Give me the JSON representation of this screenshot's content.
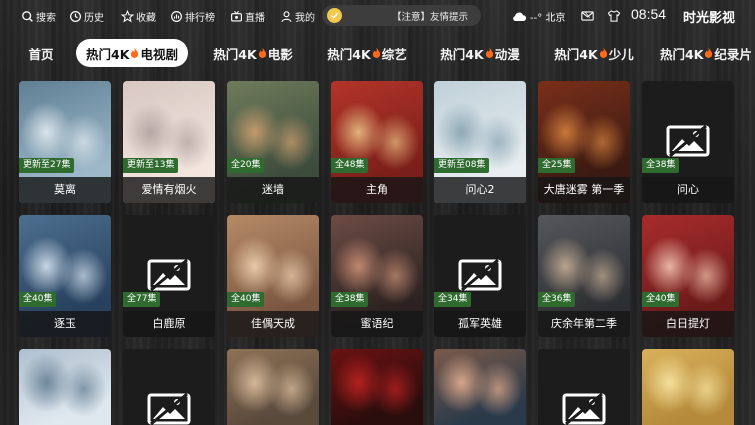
{
  "topbar": {
    "nav": [
      {
        "label": "搜索",
        "icon": "search-icon"
      },
      {
        "label": "历史",
        "icon": "history-icon"
      },
      {
        "label": "收藏",
        "icon": "star-icon"
      },
      {
        "label": "排行榜",
        "icon": "ranking-icon"
      },
      {
        "label": "直播",
        "icon": "live-tv-icon"
      },
      {
        "label": "我的",
        "icon": "user-icon"
      }
    ],
    "notice_text": "【注意】友情提示",
    "weather": "--° 北京",
    "time": "08:54",
    "app_name": "时光影视"
  },
  "tabs": [
    {
      "label": "首页"
    },
    {
      "prefix": "热门4K",
      "suffix": "电视剧",
      "active": true
    },
    {
      "prefix": "热门4K",
      "suffix": "电影"
    },
    {
      "prefix": "热门4K",
      "suffix": "综艺"
    },
    {
      "prefix": "热门4K",
      "suffix": "动漫"
    },
    {
      "prefix": "热门4K",
      "suffix": "少儿"
    },
    {
      "prefix": "热门4K",
      "suffix": "纪录片"
    }
  ],
  "cards": [
    {
      "title": "莫离",
      "badge": "更新至27集",
      "palette": [
        "#9db8c9",
        "#5f7f94",
        "#d9e3ea"
      ]
    },
    {
      "title": "爱情有烟火",
      "badge": "更新至13集",
      "palette": [
        "#f2e6df",
        "#d8c7c2",
        "#b7a7a4"
      ]
    },
    {
      "title": "迷墙",
      "badge": "全20集",
      "palette": [
        "#3d4b3d",
        "#6e7b5a",
        "#c49a6c"
      ]
    },
    {
      "title": "主角",
      "badge": "全48集",
      "palette": [
        "#7a1f19",
        "#b3342a",
        "#e1b07a"
      ]
    },
    {
      "title": "问心2",
      "badge": "更新至08集",
      "palette": [
        "#e8eef1",
        "#bfd0d8",
        "#8fa9b5"
      ]
    },
    {
      "title": "大唐迷雾 第一季",
      "badge": "全25集",
      "palette": [
        "#3a1a12",
        "#7a2f1a",
        "#c9793a"
      ]
    },
    {
      "title": "问心",
      "badge": "全38集",
      "palette": []
    },
    {
      "title": "逐玉",
      "badge": "全40集",
      "palette": [
        "#27415e",
        "#4d6f8f",
        "#c7d6e4"
      ]
    },
    {
      "title": "白鹿原",
      "badge": "全77集",
      "palette": []
    },
    {
      "title": "佳偶天成",
      "badge": "全40集",
      "palette": [
        "#7a5540",
        "#b58a66",
        "#e7c9a8"
      ]
    },
    {
      "title": "蜜语纪",
      "badge": "全38集",
      "palette": [
        "#2b2221",
        "#6d4c44",
        "#c0876f"
      ]
    },
    {
      "title": "孤军英雄",
      "badge": "全34集",
      "palette": []
    },
    {
      "title": "庆余年第二季",
      "badge": "全36集",
      "palette": [
        "#2e2f33",
        "#55575c",
        "#b9a48c"
      ]
    },
    {
      "title": "白日提灯",
      "badge": "全40集",
      "palette": [
        "#6b1a1a",
        "#a82c2c",
        "#e7b4a0"
      ]
    },
    {
      "title": "",
      "badge": "",
      "palette": [
        "#dfe8ef",
        "#aebfce",
        "#6e879c"
      ]
    },
    {
      "title": "",
      "badge": "",
      "palette": []
    },
    {
      "title": "",
      "badge": "",
      "palette": [
        "#5a4a3c",
        "#8f7256",
        "#d5b89a"
      ]
    },
    {
      "title": "",
      "badge": "",
      "palette": [
        "#2a0d0d",
        "#6b1212",
        "#b52020"
      ]
    },
    {
      "title": "",
      "badge": "",
      "palette": [
        "#2a3a4a",
        "#7a5a4a",
        "#d7a58a"
      ]
    },
    {
      "title": "",
      "badge": "",
      "palette": []
    },
    {
      "title": "",
      "badge": "",
      "palette": [
        "#b58a3a",
        "#d8b05a",
        "#f3df9a"
      ]
    }
  ]
}
